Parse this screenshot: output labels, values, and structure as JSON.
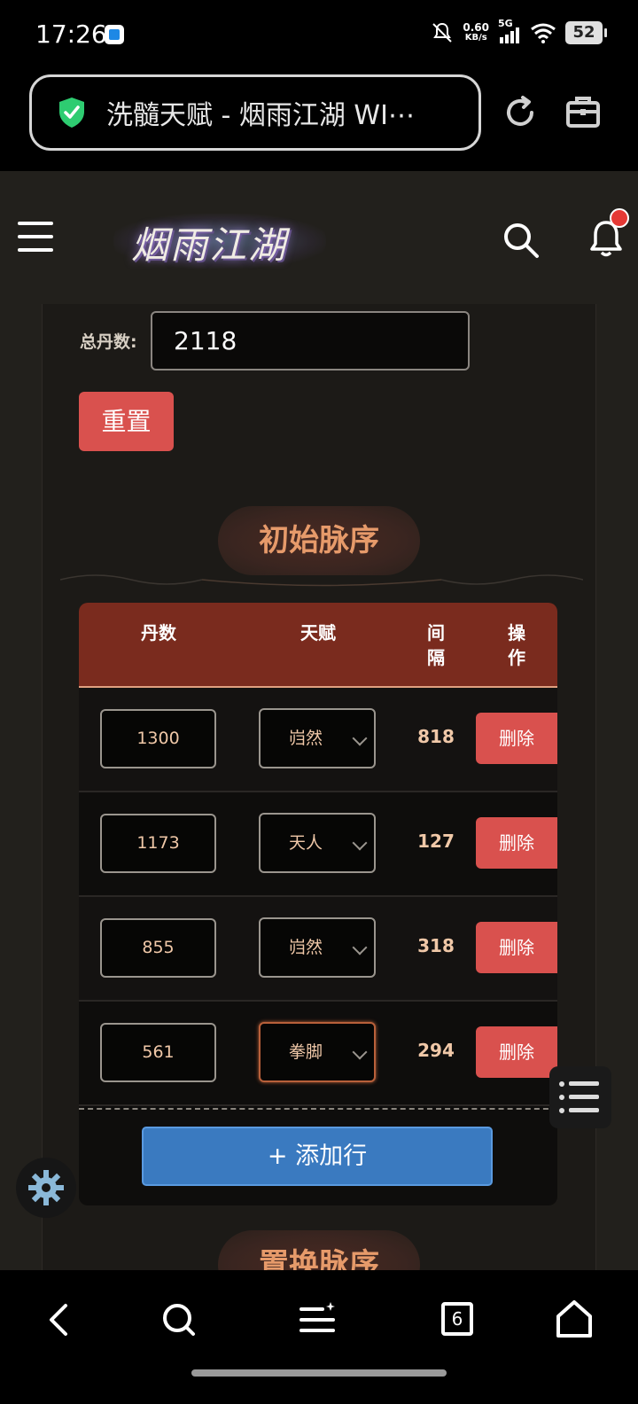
{
  "status_bar": {
    "time": "17:26",
    "net_speed_value": "0.60",
    "net_speed_unit": "KB/s",
    "network": "5G",
    "battery": "52"
  },
  "browser": {
    "url_title": "洗髓天赋 - 烟雨江湖 WI⋯"
  },
  "header": {
    "logo_text": "烟雨江湖"
  },
  "form": {
    "total_label": "总丹数:",
    "total_value": "2118",
    "reset_label": "重置"
  },
  "section1": {
    "title": "初始脉序"
  },
  "section2": {
    "title": "置换脉序"
  },
  "table": {
    "headers": [
      "丹数",
      "天赋",
      "间\n隔",
      "操\n作"
    ],
    "rows": [
      {
        "dan": "1300",
        "talent": "岿然",
        "gap": "818",
        "action": "删除"
      },
      {
        "dan": "1173",
        "talent": "天人",
        "gap": "127",
        "action": "删除"
      },
      {
        "dan": "855",
        "talent": "岿然",
        "gap": "318",
        "action": "删除"
      },
      {
        "dan": "561",
        "talent": "拳脚",
        "gap": "294",
        "action": "删除"
      }
    ],
    "add_row_label": "+ 添加行"
  },
  "bottom_nav": {
    "tabs_count": "6"
  },
  "colors": {
    "accent_red": "#d9514e",
    "header_brown": "#7a2b1e",
    "add_blue": "#3a7ac0",
    "title_orange": "#e69a6a"
  }
}
